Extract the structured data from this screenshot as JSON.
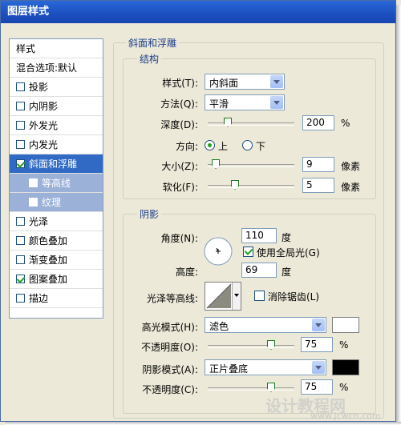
{
  "window": {
    "title": "图层样式"
  },
  "left_panel": {
    "items": [
      {
        "label": "样式",
        "type": "plain"
      },
      {
        "label": "混合选项:默认",
        "type": "plain"
      },
      {
        "label": "投影",
        "checked": false
      },
      {
        "label": "内阴影",
        "checked": false
      },
      {
        "label": "外发光",
        "checked": false
      },
      {
        "label": "内发光",
        "checked": false
      },
      {
        "label": "斜面和浮雕",
        "checked": true,
        "selected": true
      },
      {
        "label": "等高线",
        "checked": false,
        "sub": true
      },
      {
        "label": "纹理",
        "checked": false,
        "sub": true
      },
      {
        "label": "光泽",
        "checked": false
      },
      {
        "label": "颜色叠加",
        "checked": false
      },
      {
        "label": "渐变叠加",
        "checked": false
      },
      {
        "label": "图案叠加",
        "checked": true
      },
      {
        "label": "描边",
        "checked": false
      }
    ]
  },
  "bevel": {
    "group_title": "斜面和浮雕",
    "structure_title": "结构",
    "style_label": "样式(T):",
    "style_value": "内斜面",
    "method_label": "方法(Q):",
    "method_value": "平滑",
    "depth_label": "深度(D):",
    "depth_value": "200",
    "depth_level": 0.2,
    "depth_unit": "%",
    "direction_label": "方向:",
    "direction_up": "上",
    "direction_down": "下",
    "direction_selected": "上",
    "size_label": "大小(Z):",
    "size_value": "9",
    "size_level": 0.05,
    "size_unit": "像素",
    "soften_label": "软化(F):",
    "soften_value": "5",
    "soften_level": 0.3,
    "soften_unit": "像素"
  },
  "shading": {
    "title": "阴影",
    "angle_label": "角度(N):",
    "angle_value": "110",
    "angle_unit": "度",
    "global_light_label": "使用全局光(G)",
    "global_light_checked": true,
    "altitude_label": "高度:",
    "altitude_value": "69",
    "altitude_unit": "度",
    "gloss_contour_label": "光泽等高线:",
    "antialias_label": "消除锯齿(L)",
    "antialias_checked": false,
    "highlight_mode_label": "高光模式(H):",
    "highlight_mode_value": "滤色",
    "highlight_color": "#ffffff",
    "highlight_opacity_label": "不透明度(O):",
    "highlight_opacity_value": "75",
    "highlight_opacity_level": 0.75,
    "highlight_opacity_unit": "%",
    "shadow_mode_label": "阴影模式(A):",
    "shadow_mode_value": "正片叠底",
    "shadow_color": "#000000",
    "shadow_opacity_label": "不透明度(C):",
    "shadow_opacity_value": "75",
    "shadow_opacity_level": 0.75,
    "shadow_opacity_unit": "%"
  },
  "watermark": {
    "text": "设计教程网",
    "url": "www.jcwcn.com"
  }
}
